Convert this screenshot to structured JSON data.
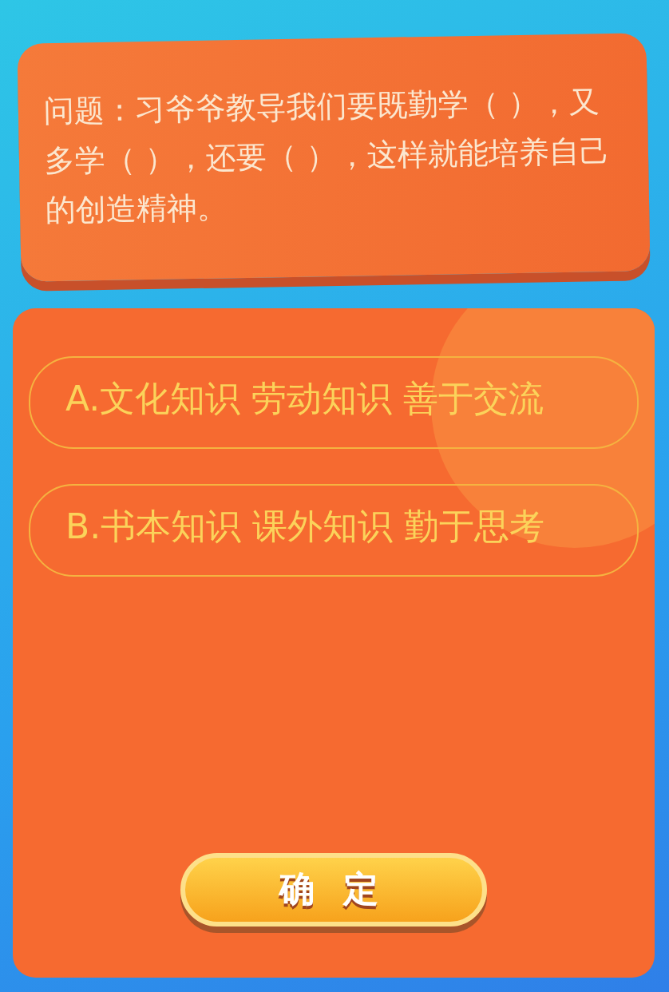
{
  "question": {
    "text": "问题：习爷爷教导我们要既勤学（ ），又多学（ ），还要（ ），这样就能培养自己的创造精神。"
  },
  "options": [
    {
      "label": "A.",
      "text": "文化知识 劳动知识 善于交流"
    },
    {
      "label": "B.",
      "text": "书本知识 课外知识 勤于思考"
    }
  ],
  "confirm_button": "确定"
}
